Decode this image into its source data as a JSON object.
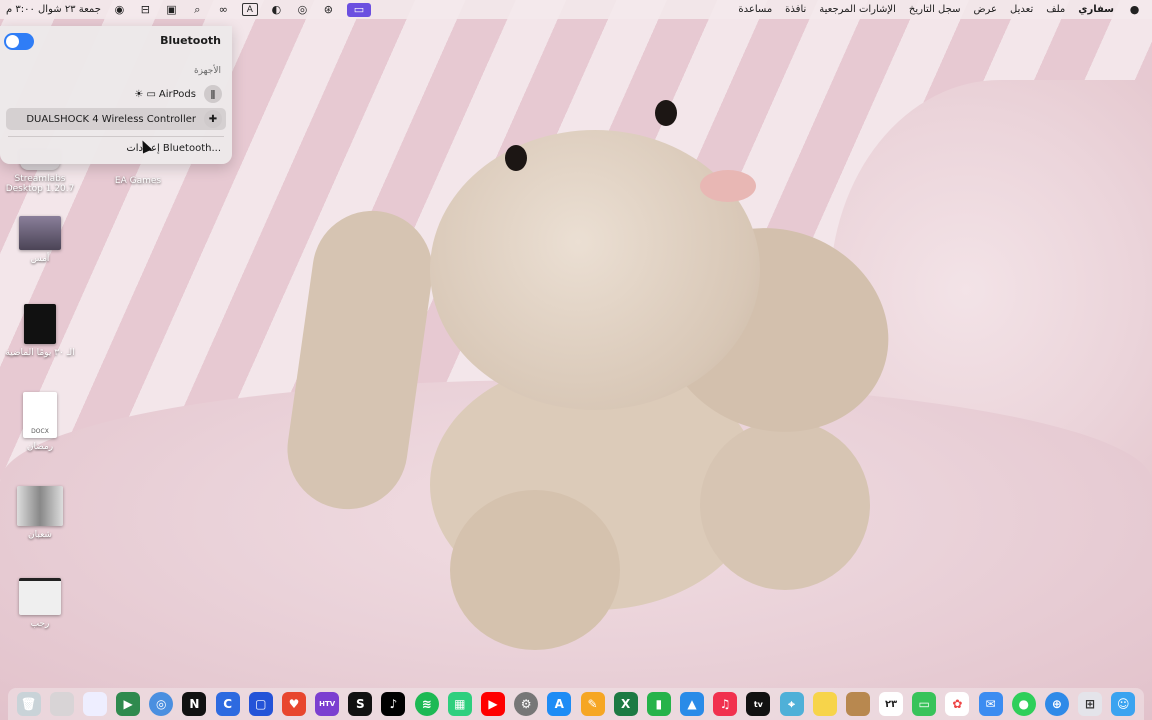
{
  "menubar": {
    "app_name": "سفاري",
    "menus": [
      "ملف",
      "تعديل",
      "عرض",
      "سجل التاريخ",
      "الإشارات المرجعية",
      "نافذة",
      "مساعدة"
    ],
    "clock": "جمعة ٢٣ شوال ٣:٠٠ م",
    "status_icons": [
      "screen-share-icon",
      "record-icon",
      "airplay-icon",
      "dark-mode-icon",
      "text-input-icon",
      "link-icon",
      "search-icon",
      "control-center-icon",
      "siri-icon"
    ]
  },
  "bluetooth": {
    "title": "Bluetooth",
    "enabled": true,
    "section_label": "الأجهزة",
    "devices": [
      {
        "name": "AirPods",
        "icon": "airpods-icon",
        "connected": true
      },
      {
        "name": "DUALSHOCK 4 Wireless Controller",
        "icon": "gamepad-icon",
        "connected": false
      }
    ],
    "settings_label": "إعدادات Bluetooth..."
  },
  "desktop": {
    "icons": [
      {
        "label": "Streamlabs Desktop 1.20.7"
      },
      {
        "label": "EA Games"
      },
      {
        "label": "أمس"
      },
      {
        "label": "الـ ٣٠ يومًا الماضية"
      },
      {
        "label": "رمضان",
        "sub": "DOCX"
      },
      {
        "label": "شعبان"
      },
      {
        "label": "رجب"
      }
    ]
  },
  "dock": {
    "items": [
      "trash",
      "downloads",
      "document",
      "facetime",
      "chrome",
      "notion",
      "capcut",
      "spotify-alt",
      "hbo-tv",
      "skype",
      "tiktok",
      "spotify",
      "grid-app",
      "youtube",
      "settings",
      "app-store",
      "pencil",
      "excel",
      "numbers",
      "keynote",
      "music",
      "apple-tv",
      "maps",
      "notes",
      "contacts",
      "calendar",
      "messages",
      "photos",
      "mail",
      "messages",
      "safari",
      "launchpad",
      "finder"
    ],
    "calendar_date": "٢٣"
  }
}
